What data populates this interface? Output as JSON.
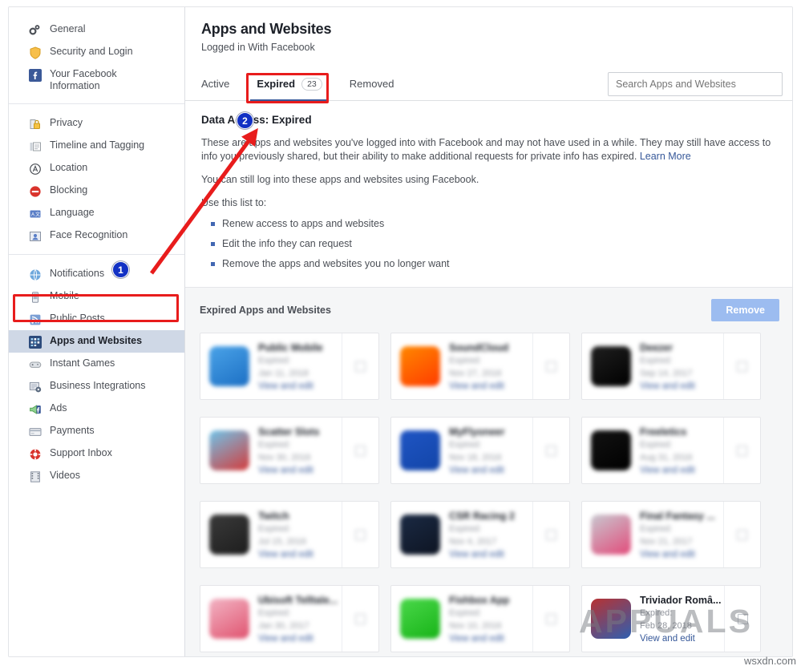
{
  "sidebar": {
    "groups": [
      {
        "items": [
          {
            "label": "General",
            "icon": "gears-icon",
            "selected": false
          },
          {
            "label": "Security and Login",
            "icon": "shield-icon",
            "selected": false
          },
          {
            "label": "Your Facebook Information",
            "icon": "facebook-icon",
            "selected": false,
            "two_line": true
          }
        ]
      },
      {
        "items": [
          {
            "label": "Privacy",
            "icon": "lock-icon",
            "selected": false
          },
          {
            "label": "Timeline and Tagging",
            "icon": "timeline-icon",
            "selected": false
          },
          {
            "label": "Location",
            "icon": "location-icon",
            "selected": false
          },
          {
            "label": "Blocking",
            "icon": "block-icon",
            "selected": false
          },
          {
            "label": "Language",
            "icon": "language-icon",
            "selected": false
          },
          {
            "label": "Face Recognition",
            "icon": "face-icon",
            "selected": false
          }
        ]
      },
      {
        "items": [
          {
            "label": "Notifications",
            "icon": "globe-icon",
            "selected": false
          },
          {
            "label": "Mobile",
            "icon": "phone-icon",
            "selected": false
          },
          {
            "label": "Public Posts",
            "icon": "rss-icon",
            "selected": false
          },
          {
            "label": "Apps and Websites",
            "icon": "apps-icon",
            "selected": true
          },
          {
            "label": "Instant Games",
            "icon": "gamepad-icon",
            "selected": false
          },
          {
            "label": "Business Integrations",
            "icon": "business-icon",
            "selected": false
          },
          {
            "label": "Ads",
            "icon": "ads-icon",
            "selected": false
          },
          {
            "label": "Payments",
            "icon": "card-icon",
            "selected": false
          },
          {
            "label": "Support Inbox",
            "icon": "lifering-icon",
            "selected": false
          },
          {
            "label": "Videos",
            "icon": "film-icon",
            "selected": false
          }
        ]
      }
    ]
  },
  "header": {
    "title": "Apps and Websites",
    "subtitle": "Logged in With Facebook"
  },
  "tabs": [
    {
      "label": "Active",
      "count": "",
      "active": false
    },
    {
      "label": "Expired",
      "count": "23",
      "active": true
    },
    {
      "label": "Removed",
      "count": "",
      "active": false
    }
  ],
  "search": {
    "placeholder": "Search Apps and Websites",
    "value": ""
  },
  "info": {
    "heading": "Data Access: Expired",
    "paragraph1": "These are apps and websites you've logged into with Facebook and may not have used in a while. They may still have access to info you previously shared, but their ability to make additional requests for private info has expired. ",
    "learn_more": "Learn More",
    "paragraph2": "You can still log into these apps and websites using Facebook.",
    "list_intro": "Use this list to:",
    "bullets": [
      "Renew access to apps and websites",
      "Edit the info they can request",
      "Remove the apps and websites you no longer want"
    ]
  },
  "grid": {
    "title": "Expired Apps and Websites",
    "remove_label": "Remove",
    "link_label": "View and edit",
    "expired_prefix": "Expired:",
    "cards": [
      {
        "name": "Public Mobile",
        "expired_label": "Expired:",
        "expired_date": "Jan 11, 2018",
        "link": "View and edit",
        "blurred": true,
        "icon_color": "#4aa3e8",
        "icon_color2": "#1c6fc4"
      },
      {
        "name": "SoundCloud",
        "expired_label": "Expired:",
        "expired_date": "Nov 27, 2016",
        "link": "View and edit",
        "blurred": true,
        "icon_color": "#ff8800",
        "icon_color2": "#ff3b00"
      },
      {
        "name": "Deezer",
        "expired_label": "Expired:",
        "expired_date": "Sep 14, 2017",
        "link": "View and edit",
        "blurred": true,
        "icon_color": "#1f1f1f",
        "icon_color2": "#000000"
      },
      {
        "name": "Scatter Slots",
        "expired_label": "Expired:",
        "expired_date": "Nov 30, 2016",
        "link": "View and edit",
        "blurred": true,
        "icon_color": "#6fc4ea",
        "icon_color2": "#d43b3b"
      },
      {
        "name": "MyFlyoneer",
        "expired_label": "Expired:",
        "expired_date": "Nov 18, 2016",
        "link": "View and edit",
        "blurred": true,
        "icon_color": "#1f55c4",
        "icon_color2": "#1245a8"
      },
      {
        "name": "Freeletics",
        "expired_label": "Expired:",
        "expired_date": "Aug 31, 2016",
        "link": "View and edit",
        "blurred": true,
        "icon_color": "#121212",
        "icon_color2": "#000000"
      },
      {
        "name": "Twitch",
        "expired_label": "Expired:",
        "expired_date": "Jul 15, 2016",
        "link": "View and edit",
        "blurred": true,
        "icon_color": "#3a3a3a",
        "icon_color2": "#1d1d1d"
      },
      {
        "name": "CSR Racing 2",
        "expired_label": "Expired:",
        "expired_date": "Nov 4, 2017",
        "link": "View and edit",
        "blurred": true,
        "icon_color": "#1b2a44",
        "icon_color2": "#0d1422"
      },
      {
        "name": "Final Fantasy ...",
        "expired_label": "Expired:",
        "expired_date": "Nov 21, 2017",
        "link": "View and edit",
        "blurred": true,
        "icon_color": "#c8c8d0",
        "icon_color2": "#e24b7a"
      },
      {
        "name": "Ubisoft Telltale...",
        "expired_label": "Expired:",
        "expired_date": "Jan 30, 2017",
        "link": "View and edit",
        "blurred": true,
        "icon_color": "#f2b4c4",
        "icon_color2": "#e0536f"
      },
      {
        "name": "Fishbox App",
        "expired_label": "Expired:",
        "expired_date": "Nov 10, 2016",
        "link": "View and edit",
        "blurred": true,
        "icon_color": "#4ad84a",
        "icon_color2": "#17b317"
      },
      {
        "name": "Triviador Româ...",
        "expired_label": "Expired:",
        "expired_date": "Feb 28, 2018",
        "link": "View and edit",
        "blurred": false,
        "icon_color": "#b83232",
        "icon_color2": "#2f5fb0"
      }
    ]
  },
  "annotations": {
    "badge1": "1",
    "badge2": "2"
  },
  "watermarks": {
    "main": "APPUALS",
    "corner": "wsxdn.com"
  },
  "colors": {
    "accent": "#365899",
    "annotation_red": "#e81c1c",
    "badge_blue": "#1231c4",
    "selected_nav": "#cfd8e6"
  }
}
